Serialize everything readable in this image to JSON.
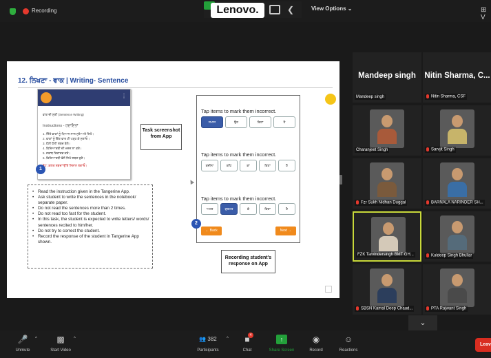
{
  "top_bar": {
    "recording_label": "Recording",
    "brand_label": "Lenovo.",
    "view_options_label": "View Options",
    "view_options_caret": "⌄",
    "gallery_view_label": "⊞ V"
  },
  "slide": {
    "title": "12. ਲਿਖਣਾ - ਵਾਕ | Writing- Sentence",
    "phone": {
      "menu_glyph": "⋮",
      "lines": [
        "ਵਾਕ ਦੀ ਸੁਣੀ (Sentence Writing)",
        "Instructions - ਹਦਾਇਤਾਂ",
        "1. ਦਿੱਤੇ ਵਾਕਾਂ ਨੂੰ ਧਿਆਨ ਨਾਲ ਸੁਣੋ ਅਤੇ ਲਿਖੋ।",
        "2. ਵਾਕਾਂ ਨੂੰ ਇੱਕ ਵਾਰ ਹੀ ਪੜ੍ਹ ਕੇ ਸੁਣਾਓ।",
        "3. ਹੌਲੀ ਹੌਲੀ ਸ਼ਬਦ ਬੋਲੋ।",
        "4. ਵਿਦਿਆਰਥੀ ਦੀ ਮਦਦ ਨਾ ਕਰੋ।",
        "5. ਜਵਾਬ ਰਿਕਾਰਡ ਕਰੋ।",
        "6. ਵਿਦਿਆਰਥੀ ਵੱਲੋਂ ਲਿਖੇ ਸ਼ਬਦ ਚੁਣੋ।",
        "ਨੋਟ: ਗ਼ਲਤ ਸ਼ਬਦਾਂ ਉੱਤੇ ਨਿਸ਼ਾਨ ਲਗਾਓ।"
      ]
    },
    "badge_1": "1",
    "badge_2": "2",
    "task_screenshot_label": "Task screenshot from App",
    "recording_response_label": "Recording student's response on App",
    "instructions": [
      "Read the instruction given in the Tangerine App.",
      "Ask student to write the sentences in the notebook/ separate paper.",
      "Do not read the sentences more than 2 times.",
      "Do not read too fast for the student.",
      "In this task, the student is expected to write letters/ words/ sentences recited to him/her.",
      "Do not try to correct the student.",
      "Record the response of the student in Tangerine App shown."
    ],
    "tablet": {
      "tap_text": "Tap items to mark them incorrect.",
      "rows": [
        [
          "ਸਮਾਜ",
          "ਉਹ",
          "ਕਿਹਾ",
          "ਹੈ"
        ],
        [
          "ਕਦੀਨਾ",
          "ਕਹਿ",
          "ਕਾ",
          "ਕਿਹਾ",
          "ਹੈ"
        ],
        [
          "ਅਮਰ",
          "ਗੁਰਮਤ",
          "ਕੇ",
          "ਕਿਹਾ",
          "ਹੈ"
        ]
      ],
      "selected": [
        [
          0
        ],
        [],
        [
          1
        ]
      ],
      "back_label": "← Back",
      "next_label": "Next →"
    }
  },
  "gallery": {
    "tiles": [
      {
        "type": "name",
        "display": "Mandeep singh",
        "label": "Mandeep singh",
        "muted": false
      },
      {
        "type": "name",
        "display": "Nitin Sharma, C...",
        "label": "Nitin Sharma, CSF",
        "muted": true
      },
      {
        "type": "video",
        "label": "Charanjeet Singh",
        "muted": false,
        "shirt": "#a85a3a"
      },
      {
        "type": "video",
        "label": "Sarvjit Singh",
        "muted": true,
        "shirt": "#c7b46a"
      },
      {
        "type": "video",
        "label": "Fzr Sukh Nidhan Duggal",
        "muted": true,
        "shirt": "#7a5a3c"
      },
      {
        "type": "video",
        "label": "BARNALA NARINDER SH...",
        "muted": true,
        "shirt": "#3a6ea5"
      },
      {
        "type": "video",
        "label": "FZK Tarvindersingh BMT GH...",
        "muted": false,
        "shirt": "#d4c9b8",
        "active": true
      },
      {
        "type": "video",
        "label": "Kuldeep Singh Bhullar",
        "muted": true,
        "shirt": "#556b7a"
      },
      {
        "type": "video",
        "label": "SBSN Kamal Deep Chaud...",
        "muted": true,
        "shirt": "#2c3e5c"
      },
      {
        "type": "video",
        "label": "PTA Rajwant Singh",
        "muted": true,
        "shirt": "#4a4a4a"
      }
    ],
    "expand_glyph": "⌄"
  },
  "toolbar": {
    "unmute_label": "Unmute",
    "start_video_label": "Start Video",
    "participants_label": "Participants",
    "participants_count": "382",
    "chat_label": "Chat",
    "chat_badge": "4",
    "share_label": "Share Screen",
    "record_label": "Record",
    "reactions_label": "Reactions",
    "leave_label": "Leav"
  },
  "colors": {
    "accent_green": "#23a03a",
    "leave_red": "#d92d20",
    "active_speaker": "#c9d93a",
    "tablet_selected": "#3a5ca8",
    "tablet_nav": "#f08a1c"
  }
}
